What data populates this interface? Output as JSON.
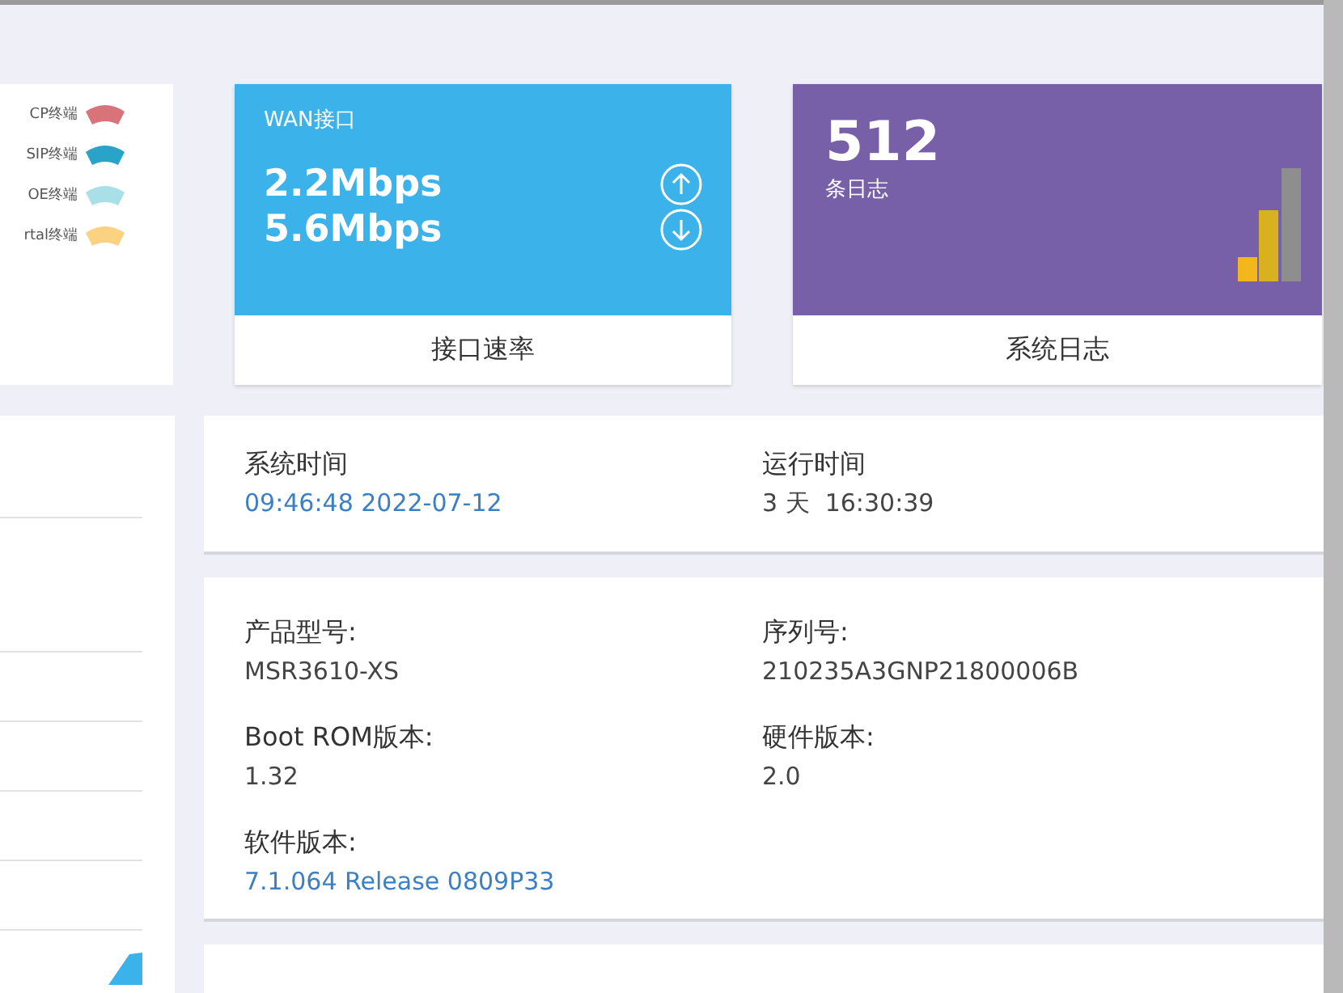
{
  "legend": [
    {
      "label": "CP终端",
      "color": "#d9737a"
    },
    {
      "label": "SIP终端",
      "color": "#2aa3c9"
    },
    {
      "label": "OE终端",
      "color": "#a9e0e8"
    },
    {
      "label": "rtal终端",
      "color": "#fbd282"
    }
  ],
  "cards": [
    {
      "kind": "speed",
      "title": "WAN接口",
      "upload": "2.2Mbps",
      "download": "5.6Mbps",
      "footer": "接口速率",
      "color": "#3bb2ea"
    },
    {
      "kind": "log",
      "count": "512",
      "caption": "条日志",
      "footer": "系统日志",
      "color": "#7760a8"
    }
  ],
  "time_panel": [
    {
      "label": "系统时间",
      "value": "09:46:48 2022-07-12",
      "link": true
    },
    {
      "label": "运行时间",
      "value": "3 天  16:30:39",
      "link": false
    }
  ],
  "device_info": [
    {
      "label": "产品型号:",
      "value": "MSR3610-XS",
      "link": false
    },
    {
      "label": "序列号:",
      "value": "210235A3GNP21800006B",
      "link": false
    },
    {
      "label": "Boot ROM版本:",
      "value": "1.32",
      "link": false
    },
    {
      "label": "硬件版本:",
      "value": "2.0",
      "link": false
    },
    {
      "label": "软件版本:",
      "value": "7.1.064 Release 0809P33",
      "link": true
    }
  ]
}
